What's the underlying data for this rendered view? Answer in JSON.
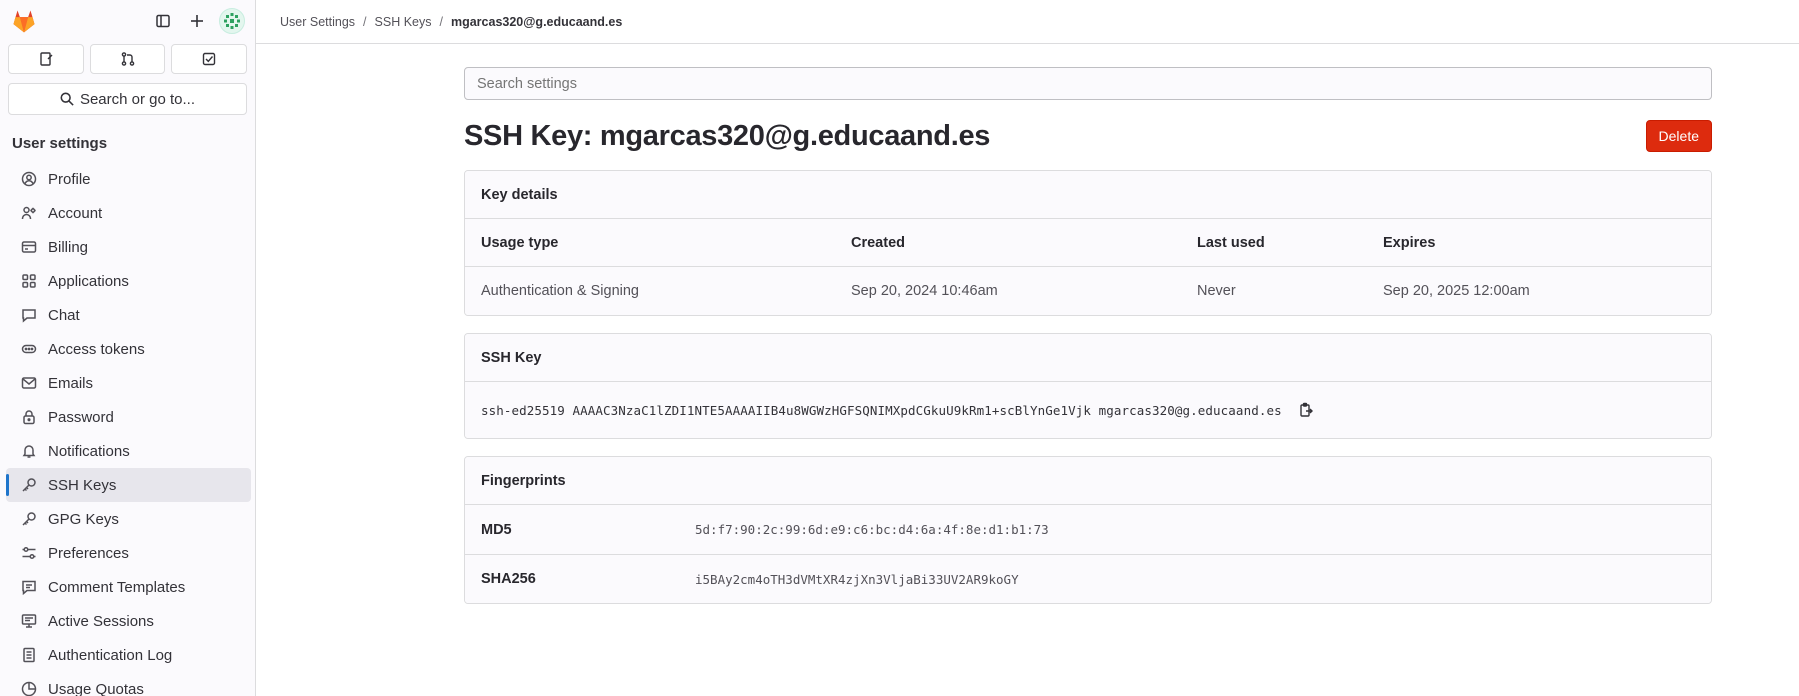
{
  "sidebar": {
    "section_title": "User settings",
    "search_label": "Search or go to...",
    "items": [
      {
        "label": "Profile",
        "icon": "profile-icon"
      },
      {
        "label": "Account",
        "icon": "account-icon"
      },
      {
        "label": "Billing",
        "icon": "billing-icon"
      },
      {
        "label": "Applications",
        "icon": "applications-icon"
      },
      {
        "label": "Chat",
        "icon": "chat-icon"
      },
      {
        "label": "Access tokens",
        "icon": "token-icon"
      },
      {
        "label": "Emails",
        "icon": "mail-icon"
      },
      {
        "label": "Password",
        "icon": "lock-icon"
      },
      {
        "label": "Notifications",
        "icon": "bell-icon"
      },
      {
        "label": "SSH Keys",
        "icon": "key-icon",
        "active": true
      },
      {
        "label": "GPG Keys",
        "icon": "key-icon"
      },
      {
        "label": "Preferences",
        "icon": "preferences-icon"
      },
      {
        "label": "Comment Templates",
        "icon": "comment-icon"
      },
      {
        "label": "Active Sessions",
        "icon": "monitor-icon"
      },
      {
        "label": "Authentication Log",
        "icon": "log-icon"
      },
      {
        "label": "Usage Quotas",
        "icon": "quota-icon"
      }
    ]
  },
  "breadcrumb": {
    "items": [
      "User Settings",
      "SSH Keys"
    ],
    "current": "mgarcas320@g.educaand.es"
  },
  "search_settings": {
    "placeholder": "Search settings"
  },
  "page": {
    "title": "SSH Key: mgarcas320@g.educaand.es",
    "delete_label": "Delete"
  },
  "key_details": {
    "header": "Key details",
    "columns": [
      "Usage type",
      "Created",
      "Last used",
      "Expires"
    ],
    "values": [
      "Authentication & Signing",
      "Sep 20, 2024 10:46am",
      "Never",
      "Sep 20, 2025 12:00am"
    ]
  },
  "ssh_key": {
    "header": "SSH Key",
    "value": "ssh-ed25519 AAAAC3NzaC1lZDI1NTE5AAAAIIB4u8WGWzHGFSQNIMXpdCGkuU9kRm1+scBlYnGe1Vjk mgarcas320@g.educaand.es"
  },
  "fingerprints": {
    "header": "Fingerprints",
    "rows": [
      {
        "label": "MD5",
        "value": "5d:f7:90:2c:99:6d:e9:c6:bc:d4:6a:4f:8e:d1:b1:73"
      },
      {
        "label": "SHA256",
        "value": "i5BAy2cm4oTH3dVMtXR4zjXn3VljaBi33UV2AR9koGY"
      }
    ]
  },
  "colors": {
    "accent": "#1f75cb",
    "danger": "#dd2b0e",
    "brand": "#e24329"
  }
}
